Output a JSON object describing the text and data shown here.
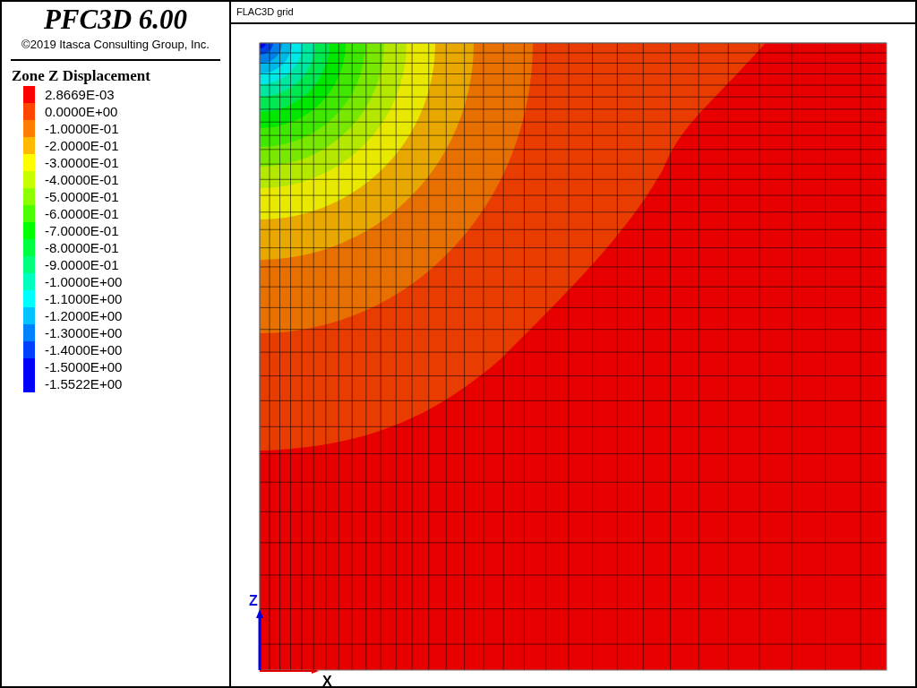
{
  "sidebar": {
    "title": "PFC3D 6.00",
    "copyright": "©2019 Itasca Consulting Group, Inc.",
    "legend_title": "Zone Z Displacement",
    "legend": [
      {
        "label": "2.8669E-03",
        "color": "#ff0000"
      },
      {
        "label": "0.0000E+00",
        "color": "#ff4600"
      },
      {
        "label": "-1.0000E-01",
        "color": "#ff7d00"
      },
      {
        "label": "-2.0000E-01",
        "color": "#ffb900"
      },
      {
        "label": "-3.0000E-01",
        "color": "#ffff00"
      },
      {
        "label": "-4.0000E-01",
        "color": "#c8ff00"
      },
      {
        "label": "-5.0000E-01",
        "color": "#8cff00"
      },
      {
        "label": "-6.0000E-01",
        "color": "#4bff00"
      },
      {
        "label": "-7.0000E-01",
        "color": "#00ff00"
      },
      {
        "label": "-8.0000E-01",
        "color": "#00ff41"
      },
      {
        "label": "-9.0000E-01",
        "color": "#00ff7d"
      },
      {
        "label": "-1.0000E+00",
        "color": "#00ffbe"
      },
      {
        "label": "-1.1000E+00",
        "color": "#00ffff"
      },
      {
        "label": "-1.2000E+00",
        "color": "#00c3ff"
      },
      {
        "label": "-1.3000E+00",
        "color": "#0082ff"
      },
      {
        "label": "-1.4000E+00",
        "color": "#0041ff"
      },
      {
        "label": "-1.5000E+00",
        "color": "#0000ff"
      },
      {
        "label": "-1.5522E+00",
        "color": "#0000ff"
      }
    ]
  },
  "plot": {
    "title": "FLAC3D grid",
    "axis_z": "Z",
    "axis_x": "X"
  }
}
